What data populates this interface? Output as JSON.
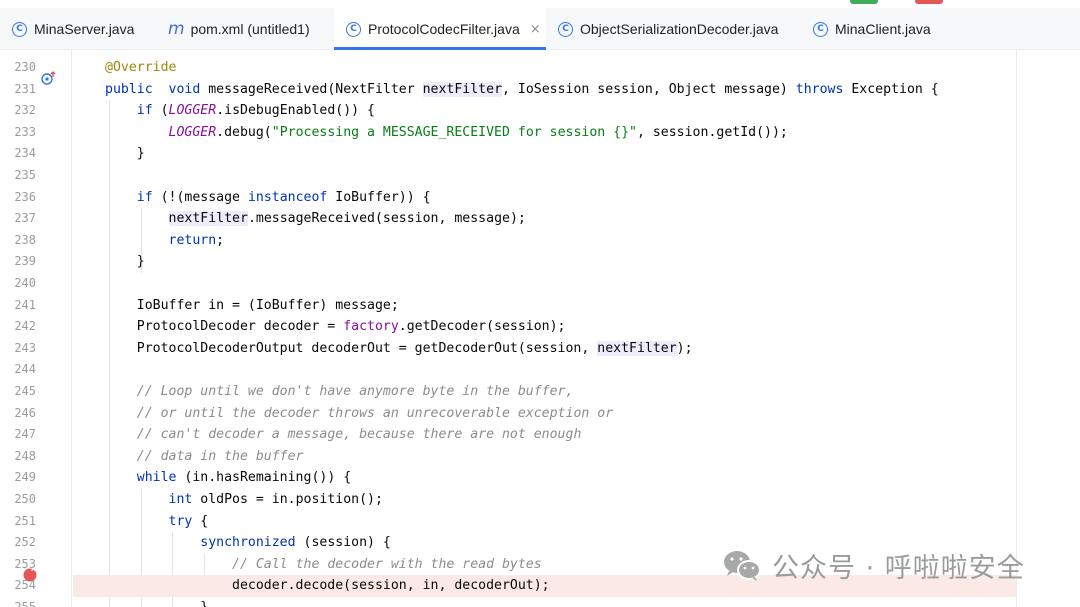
{
  "tabs": [
    {
      "label": "MinaServer.java",
      "icon": "class-icon",
      "active": false
    },
    {
      "label": "pom.xml (untitled1)",
      "icon": "maven-icon",
      "active": false
    },
    {
      "label": "ProtocolCodecFilter.java",
      "icon": "class-icon",
      "active": true,
      "closable": true
    },
    {
      "label": "ObjectSerializationDecoder.java",
      "icon": "class-icon",
      "active": false
    },
    {
      "label": "MinaClient.java",
      "icon": "class-icon",
      "active": false
    }
  ],
  "tab_icon_glyph": "C",
  "tab_maven_glyph": "m",
  "close_glyph": "×",
  "line_numbers": [
    "230",
    "231",
    "232",
    "233",
    "234",
    "235",
    "236",
    "237",
    "238",
    "239",
    "240",
    "241",
    "242",
    "243",
    "244",
    "245",
    "246",
    "247",
    "248",
    "249",
    "250",
    "251",
    "252",
    "253",
    "254",
    "255"
  ],
  "breakpoint_line": "254",
  "code_lines": [
    [
      [
        "ann",
        "@Override"
      ]
    ],
    [
      [
        "kw",
        "public"
      ],
      [
        "",
        "  "
      ],
      [
        "kw",
        "void"
      ],
      [
        "",
        " messageReceived(NextFilter "
      ],
      [
        "hl",
        "nextFilter"
      ],
      [
        "",
        ", IoSession session, Object message) "
      ],
      [
        "kw",
        "throws"
      ],
      [
        "",
        " Exception {"
      ]
    ],
    [
      [
        "",
        "    "
      ],
      [
        "kw",
        "if"
      ],
      [
        "",
        " ("
      ],
      [
        "st",
        "LOGGER"
      ],
      [
        "",
        ".isDebugEnabled()) {"
      ]
    ],
    [
      [
        "",
        "        "
      ],
      [
        "st",
        "LOGGER"
      ],
      [
        "",
        ".debug("
      ],
      [
        "str",
        "\"Processing a MESSAGE_RECEIVED for session {}\""
      ],
      [
        "",
        ", session.getId());"
      ]
    ],
    [
      [
        "",
        "    }"
      ]
    ],
    [],
    [
      [
        "",
        "    "
      ],
      [
        "kw",
        "if"
      ],
      [
        "",
        " (!(message "
      ],
      [
        "kw",
        "instanceof"
      ],
      [
        "",
        " IoBuffer)) {"
      ]
    ],
    [
      [
        "",
        "        "
      ],
      [
        "hl",
        "nextFilter"
      ],
      [
        "",
        ".messageReceived(session, message);"
      ]
    ],
    [
      [
        "",
        "        "
      ],
      [
        "kw",
        "return"
      ],
      [
        "",
        ";"
      ]
    ],
    [
      [
        "",
        "    }"
      ]
    ],
    [],
    [
      [
        "",
        "    IoBuffer in = (IoBuffer) message;"
      ]
    ],
    [
      [
        "",
        "    ProtocolDecoder decoder = "
      ],
      [
        "fld",
        "factory"
      ],
      [
        "",
        ".getDecoder(session);"
      ]
    ],
    [
      [
        "",
        "    ProtocolDecoderOutput decoderOut = getDecoderOut(session, "
      ],
      [
        "hl",
        "nextFilter"
      ],
      [
        "",
        ");"
      ]
    ],
    [],
    [
      [
        "",
        "    "
      ],
      [
        "cm",
        "// Loop until we don't have anymore byte in the buffer,"
      ]
    ],
    [
      [
        "",
        "    "
      ],
      [
        "cm",
        "// or until the decoder throws an unrecoverable exception or"
      ]
    ],
    [
      [
        "",
        "    "
      ],
      [
        "cm",
        "// can't decoder a message, because there are not enough"
      ]
    ],
    [
      [
        "",
        "    "
      ],
      [
        "cm",
        "// data in the buffer"
      ]
    ],
    [
      [
        "",
        "    "
      ],
      [
        "kw",
        "while"
      ],
      [
        "",
        " (in.hasRemaining()) {"
      ]
    ],
    [
      [
        "",
        "        "
      ],
      [
        "kw",
        "int"
      ],
      [
        "",
        " oldPos = in.position();"
      ]
    ],
    [
      [
        "",
        "        "
      ],
      [
        "kw",
        "try"
      ],
      [
        "",
        " {"
      ]
    ],
    [
      [
        "",
        "            "
      ],
      [
        "kw",
        "synchronized"
      ],
      [
        "",
        " (session) {"
      ]
    ],
    [
      [
        "",
        "                "
      ],
      [
        "cm",
        "// Call the decoder with the read bytes"
      ]
    ],
    [
      [
        "",
        "                decoder.decode(session, in, decoderOut);"
      ]
    ],
    [
      [
        "",
        "            }"
      ]
    ]
  ],
  "watermark": {
    "text": "公众号 · 呼啦啦安全",
    "icon": "wechat-icon"
  },
  "colors": {
    "accent": "#3574f0",
    "keyword": "#0033b3",
    "string": "#067d17",
    "comment": "#8c8c8c",
    "annotation": "#9e880d",
    "static": "#871094",
    "breakpoint": "#e55757"
  }
}
